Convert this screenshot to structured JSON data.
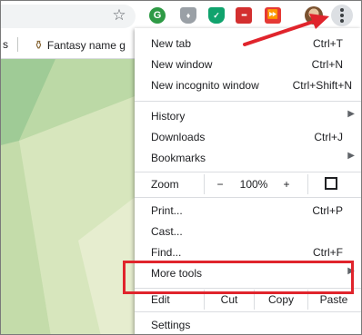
{
  "toolbar": {
    "extensions": [
      {
        "name": "grammarly",
        "glyph": "G"
      },
      {
        "name": "shield-grey",
        "glyph": "♦"
      },
      {
        "name": "shield-green",
        "glyph": "✓"
      },
      {
        "name": "red-extension",
        "glyph": "▪▪▪"
      },
      {
        "name": "red-skip",
        "glyph": "⏩"
      }
    ]
  },
  "bookmarks": {
    "item_label": "Fantasy name g"
  },
  "menu": {
    "new_tab": {
      "label": "New tab",
      "shortcut": "Ctrl+T"
    },
    "new_window": {
      "label": "New window",
      "shortcut": "Ctrl+N"
    },
    "new_incognito": {
      "label": "New incognito window",
      "shortcut": "Ctrl+Shift+N"
    },
    "history": {
      "label": "History"
    },
    "downloads": {
      "label": "Downloads",
      "shortcut": "Ctrl+J"
    },
    "bookmarks": {
      "label": "Bookmarks"
    },
    "zoom": {
      "label": "Zoom",
      "minus": "−",
      "level": "100%",
      "plus": "+"
    },
    "print": {
      "label": "Print...",
      "shortcut": "Ctrl+P"
    },
    "cast": {
      "label": "Cast..."
    },
    "find": {
      "label": "Find...",
      "shortcut": "Ctrl+F"
    },
    "more_tools": {
      "label": "More tools"
    },
    "edit": {
      "label": "Edit",
      "cut": "Cut",
      "copy": "Copy",
      "paste": "Paste"
    },
    "settings": {
      "label": "Settings"
    }
  },
  "colors": {
    "annotation": "#e0242c",
    "page_background": "#f4f6ec"
  }
}
